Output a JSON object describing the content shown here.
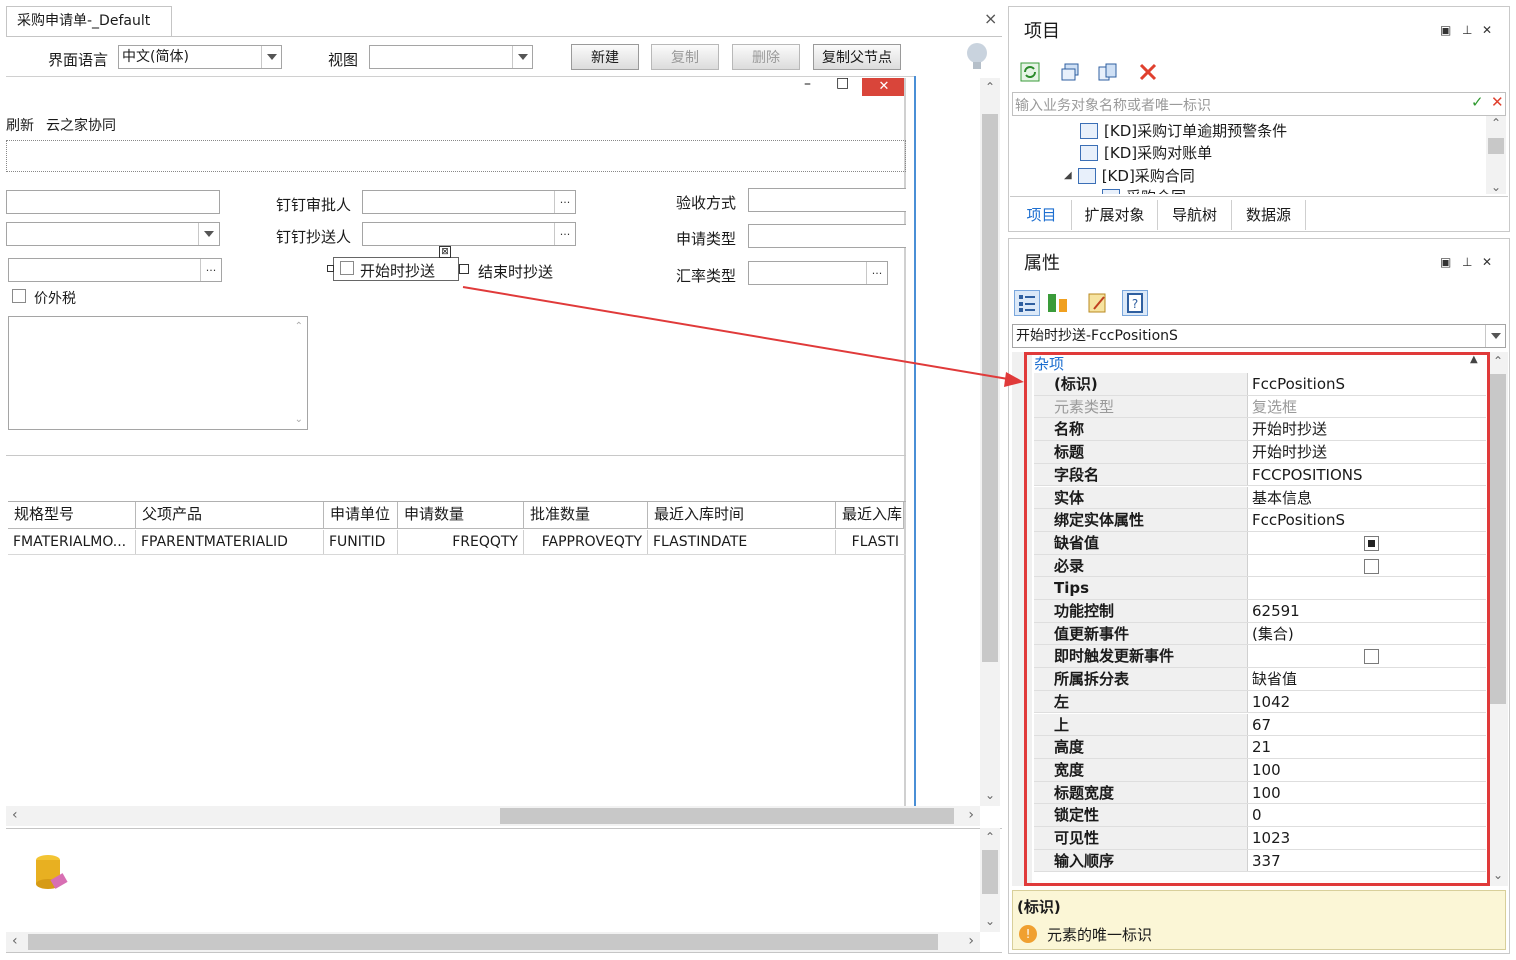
{
  "doc_tab": {
    "title": "采购申请单-_Default",
    "close": "×"
  },
  "toolbar": {
    "lang_label": "界面语言",
    "lang_value": "中文(简体)",
    "view_label": "视图",
    "view_value": "",
    "new_label": "新建",
    "copy_label": "复制",
    "delete_label": "删除",
    "copy_parent_label": "复制父节点"
  },
  "subwindow": {
    "min": "–",
    "max": "□",
    "close": "✕"
  },
  "form_menu": {
    "refresh": "刷新",
    "yun_collab": "云之家协同"
  },
  "form_labels": {
    "dingding_approver": "钉钉审批人",
    "dingding_cc": "钉钉抄送人",
    "start_cc": "开始时抄送",
    "end_cc": "结束时抄送",
    "accept_method": "验收方式",
    "apply_type": "申请类型",
    "rate_type": "汇率类型",
    "tax_excluded": "价外税",
    "ellipsis": "···"
  },
  "grid": {
    "headers": [
      "规格型号",
      "父项产品",
      "申请单位",
      "申请数量",
      "批准数量",
      "最近入库时间",
      "最近入库"
    ],
    "row": [
      "FMATERIALMO...",
      "FPARENTMATERIALID",
      "FUNITID",
      "FREQQTY",
      "FAPPROVEQTY",
      "FLASTINDATE",
      "FLASTI"
    ]
  },
  "project_panel": {
    "title": "项目",
    "search_placeholder": "输入业务对象名称或者唯一标识",
    "tree": [
      "[KD]采购订单逾期预警条件",
      "[KD]采购对账单",
      "[KD]采购合同",
      "采购合同"
    ],
    "tabs": [
      "项目",
      "扩展对象",
      "导航树",
      "数据源"
    ],
    "window_icons": {
      "pin": "▣",
      "float": "⊥",
      "close": "✕"
    }
  },
  "property_panel": {
    "title": "属性",
    "selected_object": "开始时抄送-FccPositionS",
    "category": "杂项",
    "rows": [
      {
        "name": "(标识)",
        "value": "FccPositionS",
        "gray": false
      },
      {
        "name": "元素类型",
        "value": "复选框",
        "gray": true
      },
      {
        "name": "名称",
        "value": "开始时抄送",
        "gray": false
      },
      {
        "name": "标题",
        "value": "开始时抄送",
        "gray": false
      },
      {
        "name": "字段名",
        "value": "FCCPOSITIONS",
        "gray": false
      },
      {
        "name": "实体",
        "value": "基本信息",
        "gray": false
      },
      {
        "name": "绑定实体属性",
        "value": "FccPositionS",
        "gray": false
      },
      {
        "name": "缺省值",
        "value": "",
        "gray": false,
        "check": "checked"
      },
      {
        "name": "必录",
        "value": "",
        "gray": false,
        "check": "empty"
      },
      {
        "name": "Tips",
        "value": "",
        "gray": false
      },
      {
        "name": "功能控制",
        "value": "62591",
        "gray": false
      },
      {
        "name": "值更新事件",
        "value": "(集合)",
        "gray": false
      },
      {
        "name": "即时触发更新事件",
        "value": "",
        "gray": false,
        "check": "empty"
      },
      {
        "name": "所属拆分表",
        "value": "缺省值",
        "gray": false
      },
      {
        "name": "左",
        "value": "1042",
        "gray": false
      },
      {
        "name": "上",
        "value": "67",
        "gray": false
      },
      {
        "name": "高度",
        "value": "21",
        "gray": false
      },
      {
        "name": "宽度",
        "value": "100",
        "gray": false
      },
      {
        "name": "标题宽度",
        "value": "100",
        "gray": false
      },
      {
        "name": "锁定性",
        "value": "0",
        "gray": false
      },
      {
        "name": "可见性",
        "value": "1023",
        "gray": false
      },
      {
        "name": "输入顺序",
        "value": "337",
        "gray": false
      }
    ],
    "help_title": "(标识)",
    "help_text": "元素的唯一标识"
  },
  "colors": {
    "highlight": "#e03a3a",
    "accent_blue": "#1e6fd0",
    "help_bg": "#fbf6d6"
  }
}
